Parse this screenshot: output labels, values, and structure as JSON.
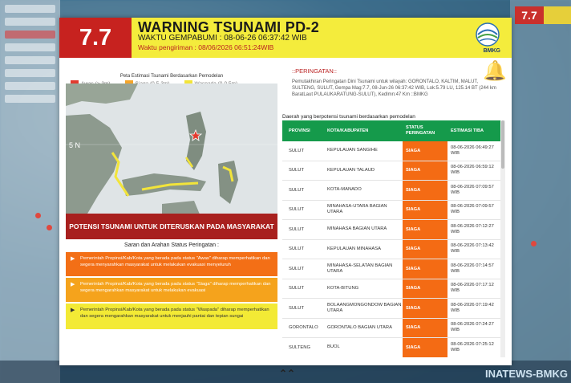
{
  "magnitude": "7.7",
  "header": {
    "title": "WARNING TSUNAMI PD-2",
    "time_line": "WAKTU GEMPABUMI : 08-06-26 06:37:42 WIB",
    "sent_line": "Waktu pengiriman : 08/06/2026 06:51:24WIB",
    "logo_label": "BMKG"
  },
  "map": {
    "title": "Peta Estimasi Tsunami Berdasarkan Pemodelan",
    "legend": [
      {
        "label": "Awas (> 3m)",
        "color": "#e23b2f"
      },
      {
        "label": "Siaga (0.5-3m)",
        "color": "#f4a52a"
      },
      {
        "label": "Waspada (0-0.5m)",
        "color": "#f2e43a"
      }
    ],
    "lat_label": "5 N"
  },
  "banner": "POTENSI TSUNAMI UNTUK DITERUSKAN PADA MASYARAKAT",
  "guidance": {
    "title": "Saran dan Arahan Status Peringatan :",
    "items": [
      "Pemerintah Propinsi/Kab/Kota yang berada pada status \"Awas\" diharap memperhatikan dan segera menyarahkan masyarakat untuk melakukan evakuasi menyeluruh",
      "Pemerintah Propinsi/Kab/Kota yang berada pada status \"Siaga\" diharap memperhatikan dan segera mengarahkan masyarakat untuk melakukan evakuasi",
      "Pemerintah Propinsi/Kab/Kota yang berada pada status \"Waspada\" diharap memperhatikan dan segera mengarahkan masyarakat untuk menjauhi pantai dan tepian sungai"
    ]
  },
  "warning": {
    "title": "::PERINGATAN::",
    "body": "Pemutakhiran Peringatan Dini Tsunami untuk wilayah: GORONTALO, KALTIM, MALUT, SULTENG, SULUT, Gempa Mag:7.7, 08-Jun-26 06:37:42 WIB, Lok:5.79 LU, 125.14 BT (244 km BaratLaut PULAUKARATUNG-SULUT), Kedlmn:47 Km ::BMKG"
  },
  "table": {
    "intro": "Daerah yang berpotensi tsunami berdasarkan pemodelan",
    "headers": [
      "PROVINSI",
      "KOTA/KABUPATEN",
      "STATUS PERINGATAN",
      "ESTIMASI TIBA"
    ],
    "rows": [
      {
        "prov": "SULUT",
        "kab": "KEPULAUAN SANGIHE",
        "status": "SIAGA",
        "eta": "08-06-2026 06:49:27 WIB"
      },
      {
        "prov": "SULUT",
        "kab": "KEPULAUAN TALAUD",
        "status": "SIAGA",
        "eta": "08-06-2026 06:59:12 WIB"
      },
      {
        "prov": "SULUT",
        "kab": "KOTA-MANADO",
        "status": "SIAGA",
        "eta": "08-06-2026 07:09:57 WIB"
      },
      {
        "prov": "SULUT",
        "kab": "MINAHASA-UTARA BAGIAN UTARA",
        "status": "SIAGA",
        "eta": "08-06-2026 07:09:57 WIB"
      },
      {
        "prov": "SULUT",
        "kab": "MINAHASA BAGIAN UTARA",
        "status": "SIAGA",
        "eta": "08-06-2026 07:12:27 WIB"
      },
      {
        "prov": "SULUT",
        "kab": "KEPULAUAN MINAHASA",
        "status": "SIAGA",
        "eta": "08-06-2026 07:13:42 WIB"
      },
      {
        "prov": "SULUT",
        "kab": "MINAHASA-SELATAN BAGIAN UTARA",
        "status": "SIAGA",
        "eta": "08-06-2026 07:14:57 WIB"
      },
      {
        "prov": "SULUT",
        "kab": "KOTA-BITUNG",
        "status": "SIAGA",
        "eta": "08-06-2026 07:17:12 WIB"
      },
      {
        "prov": "SULUT",
        "kab": "BOLAANGMONGONDOW BAGIAN UTARA",
        "status": "SIAGA",
        "eta": "08-06-2026 07:19:42 WIB"
      },
      {
        "prov": "GORONTALO",
        "kab": "GORONTALO BAGIAN UTARA",
        "status": "SIAGA",
        "eta": "08-06-2026 07:24:27 WIB"
      },
      {
        "prov": "SULTENG",
        "kab": "BUOL",
        "status": "SIAGA",
        "eta": "08-06-2026 07:25:12 WIB"
      }
    ]
  },
  "background": {
    "right_mag": "7.7",
    "right_logo": "INATEWS-BMKG"
  }
}
